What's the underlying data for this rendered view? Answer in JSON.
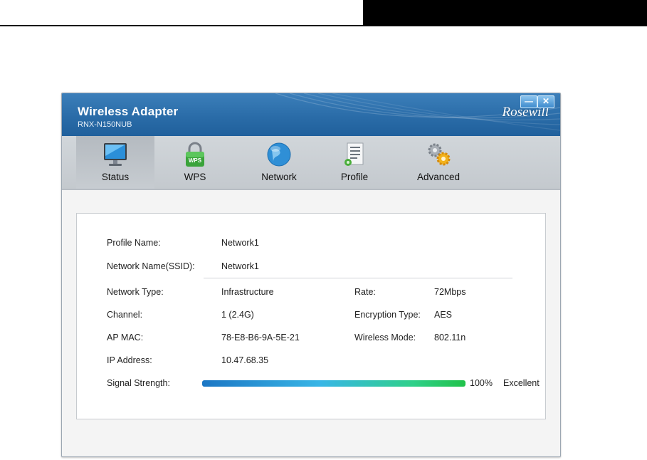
{
  "window": {
    "title": "Wireless Adapter",
    "subtitle": "RNX-N150NUB",
    "brand": "Rosewill",
    "minimize_glyph": "—",
    "close_glyph": "✕"
  },
  "toolbar": {
    "items": [
      {
        "label": "Status",
        "icon": "monitor-icon",
        "active": true
      },
      {
        "label": "WPS",
        "icon": "wps-lock-icon",
        "active": false
      },
      {
        "label": "Network",
        "icon": "globe-icon",
        "active": false
      },
      {
        "label": "Profile",
        "icon": "profile-document-icon",
        "active": false
      },
      {
        "label": "Advanced",
        "icon": "gears-icon",
        "active": false
      }
    ]
  },
  "status": {
    "profile_name_label": "Profile Name:",
    "profile_name": "Network1",
    "ssid_label": "Network Name(SSID):",
    "ssid": "Network1",
    "network_type_label": "Network Type:",
    "network_type": "Infrastructure",
    "channel_label": "Channel:",
    "channel": "1 (2.4G)",
    "ap_mac_label": "AP MAC:",
    "ap_mac": "78-E8-B6-9A-5E-21",
    "ip_label": "IP Address:",
    "ip": "10.47.68.35",
    "rate_label": "Rate:",
    "rate": "72Mbps",
    "encryption_label": "Encryption Type:",
    "encryption": "AES",
    "wireless_mode_label": "Wireless Mode:",
    "wireless_mode": "802.11n",
    "signal_label": "Signal Strength:",
    "signal_percent_text": "100%",
    "signal_quality": "Excellent",
    "signal_level": 1.0
  },
  "colors": {
    "titlebar": "#2a6ca8",
    "signal_start": "#1b76c4",
    "signal_end": "#21c24a"
  }
}
